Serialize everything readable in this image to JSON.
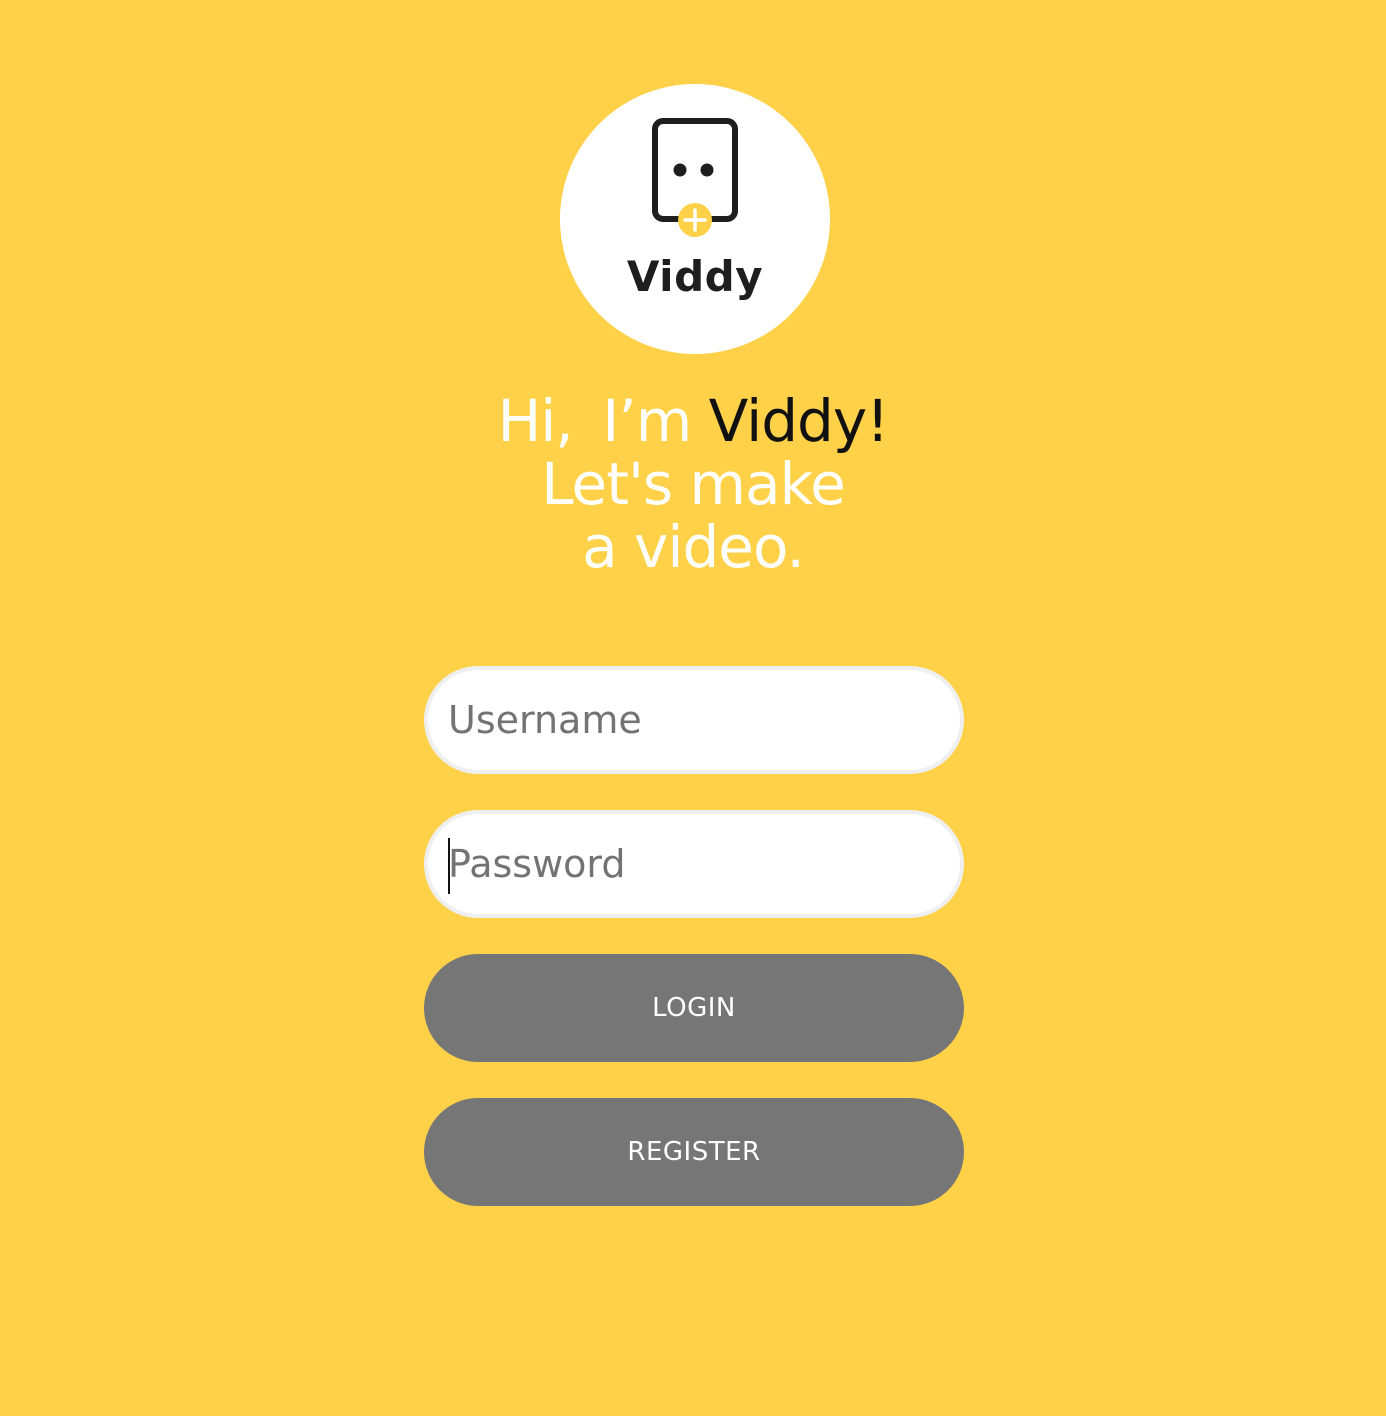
{
  "brand": {
    "logo_text": "Viddy",
    "icon": "robot-face-plus-icon",
    "accent_color": "#FFD148"
  },
  "headline": {
    "greeting": "Hi,",
    "im": "I’m",
    "name": "Viddy!",
    "line2": "Let's make",
    "line3": "a video."
  },
  "form": {
    "username_placeholder": "Username",
    "username_value": "",
    "password_placeholder": "Password",
    "password_value": "",
    "login_label": "LOGIN",
    "register_label": "REGISTER",
    "button_color": "#767676"
  }
}
